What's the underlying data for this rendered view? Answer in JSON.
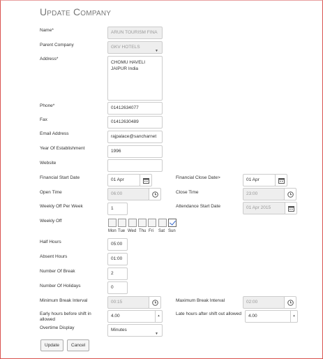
{
  "title": "Update Company",
  "fields": {
    "name": {
      "label": "Name*",
      "value": "ARUN TOURISM FINA"
    },
    "parent_company": {
      "label": "Parent Company",
      "value": "GKV HOTELS"
    },
    "address": {
      "label": "Address*",
      "line1": "CHOMU HAVELI",
      "line2": "JAIPUR India"
    },
    "phone": {
      "label": "Phone*",
      "value": "01412634077"
    },
    "fax": {
      "label": "Fax",
      "value": "01412630489"
    },
    "email": {
      "label": "Email Address",
      "value": "rajpalace@sancharnet"
    },
    "year_of_establishment": {
      "label": "Year Of Establishment",
      "value": "1996"
    },
    "website": {
      "label": "Website",
      "value": ""
    },
    "financial_start_date": {
      "label": "Financial Start Date",
      "value": "01 Apr"
    },
    "financial_close_date": {
      "label": "Financial Close Date>",
      "value": "01 Apr"
    },
    "open_time": {
      "label": "Open Time",
      "value": "06:00"
    },
    "close_time": {
      "label": "Close Time",
      "value": "23:00"
    },
    "weekly_off_per_week": {
      "label": "Weekly Off Per Week",
      "value": "1"
    },
    "attendance_start_date": {
      "label": "Attendance Start Date",
      "value": "01 Apr 2015"
    },
    "weekly_off": {
      "label": "Weekly Off",
      "days": [
        "Mon",
        "Tue",
        "Wed",
        "Thu",
        "Fri",
        "Sat",
        "Sun"
      ],
      "checked": [
        false,
        false,
        false,
        false,
        false,
        false,
        true
      ]
    },
    "half_hours": {
      "label": "Half Hours",
      "value": "05:00"
    },
    "absent_hours": {
      "label": "Absent Hours",
      "value": "01:00"
    },
    "number_of_break": {
      "label": "Number Of Break",
      "value": "2"
    },
    "number_of_holidays": {
      "label": "Number Of Holidays",
      "value": "0"
    },
    "minimum_break_interval": {
      "label": "Minimum Break Interval",
      "value": "00:15"
    },
    "maximum_break_interval": {
      "label": "Maximum Break Interval",
      "value": "02:00"
    },
    "early_hours": {
      "label": "Early hours before shift in allowed",
      "value": "4.00"
    },
    "late_hours": {
      "label": "Late hours after shift out allowed",
      "value": "4.00"
    },
    "overtime_display": {
      "label": "Overtime Display",
      "value": "Minutes"
    }
  },
  "buttons": {
    "update": "Update",
    "cancel": "Cancel"
  },
  "icons": {
    "calendar": "calendar-icon",
    "clock": "clock-icon",
    "caret": "caret-down-icon",
    "spinner": "spinner-arrows-icon"
  }
}
